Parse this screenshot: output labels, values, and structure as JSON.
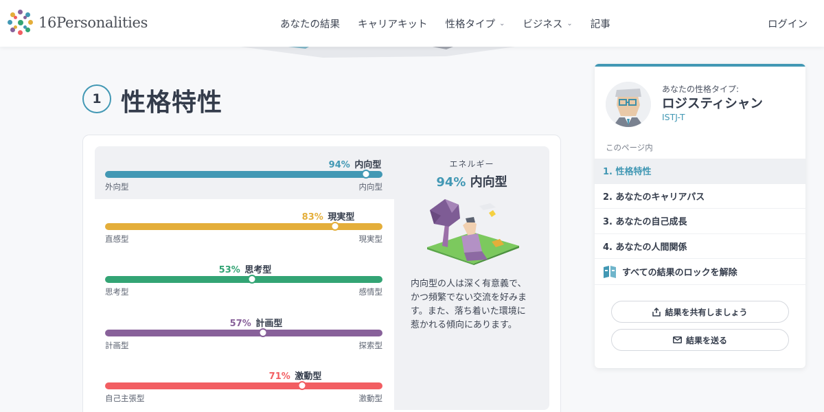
{
  "header": {
    "logo_text": "16Personalities",
    "nav": [
      {
        "label": "あなたの結果",
        "dropdown": false
      },
      {
        "label": "キャリアキット",
        "dropdown": false
      },
      {
        "label": "性格タイプ",
        "dropdown": true
      },
      {
        "label": "ビジネス",
        "dropdown": true
      },
      {
        "label": "記事",
        "dropdown": false
      }
    ],
    "login_label": "ログイン"
  },
  "section": {
    "number": "1",
    "title": "性格特性"
  },
  "traits": [
    {
      "percent": "94%",
      "name": "内向型",
      "left": "外向型",
      "right": "内向型",
      "value": 0.94,
      "color": "#4298b4"
    },
    {
      "percent": "83%",
      "name": "現実型",
      "left": "直感型",
      "right": "現実型",
      "value": 0.83,
      "color": "#e4ae3a"
    },
    {
      "percent": "53%",
      "name": "思考型",
      "left": "思考型",
      "right": "感情型",
      "value": 0.53,
      "color": "#33a474"
    },
    {
      "percent": "57%",
      "name": "計画型",
      "left": "計画型",
      "right": "探索型",
      "value": 0.57,
      "color": "#88619a"
    },
    {
      "percent": "71%",
      "name": "激動型",
      "left": "自己主張型",
      "right": "激動型",
      "value": 0.71,
      "color": "#f25e62"
    }
  ],
  "energy": {
    "label": "エネルギー",
    "percent": "94%",
    "name": "内向型",
    "description": "内向型の人は深く有意義で、かつ頻繁でない交流を好みます。また、落ち着いた環境に惹かれる傾向にあります。"
  },
  "sidebar": {
    "caption": "あなたの性格タイプ:",
    "type_name": "ロジスティシャン",
    "type_code": "ISTJ-T",
    "toc_caption": "このページ内",
    "toc": [
      {
        "label": "1. 性格特性",
        "active": true
      },
      {
        "label": "2. あなたのキャリアパス",
        "active": false
      },
      {
        "label": "3. あなたの自己成長",
        "active": false
      },
      {
        "label": "4. あなたの人間関係",
        "active": false
      }
    ],
    "unlock_label": "すべての結果のロックを解除",
    "share_label": "結果を共有しましょう",
    "send_label": "結果を送る"
  },
  "colors": {
    "accent": "#4298b4",
    "text": "#343c4b"
  }
}
